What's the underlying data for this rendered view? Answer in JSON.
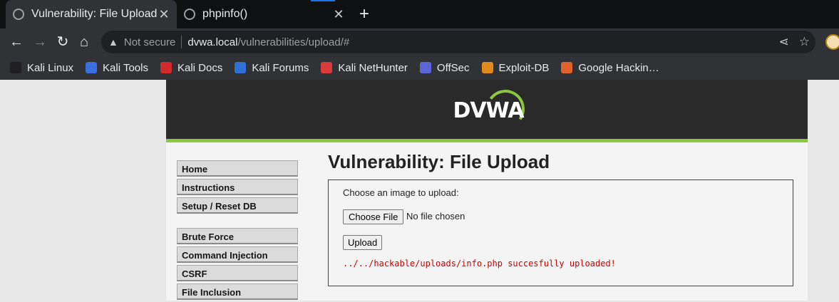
{
  "browser": {
    "tabs": [
      {
        "title": "Vulnerability: File Upload",
        "active": true
      },
      {
        "title": "phpinfo()",
        "active": false
      }
    ],
    "new_tab": "+",
    "nav": {
      "back": "←",
      "forward": "→",
      "reload": "↻",
      "home": "⌂"
    },
    "omnibox": {
      "security_icon": "warning-triangle-icon",
      "security_text": "Not secure",
      "url_host": "dvwa.local",
      "url_path": "/vulnerabilities/upload/#"
    },
    "bookmarks": [
      {
        "label": "Kali Linux",
        "icon": "kali-dragon-icon",
        "color": "#1f1f1f"
      },
      {
        "label": "Kali Tools",
        "icon": "kali-tools-icon",
        "color": "#3d6ee0"
      },
      {
        "label": "Kali Docs",
        "icon": "kali-docs-icon",
        "color": "#d12a2a"
      },
      {
        "label": "Kali Forums",
        "icon": "kali-forums-icon",
        "color": "#2f6fd6"
      },
      {
        "label": "Kali NetHunter",
        "icon": "nethunter-icon",
        "color": "#d93a3a"
      },
      {
        "label": "OffSec",
        "icon": "offsec-icon",
        "color": "#5a66d6"
      },
      {
        "label": "Exploit-DB",
        "icon": "exploit-db-spider-icon",
        "color": "#e08a1a"
      },
      {
        "label": "Google Hackin…",
        "icon": "ghdb-icon",
        "color": "#e0622a"
      }
    ]
  },
  "dvwa": {
    "logo_text": "DVWA",
    "menu_group1": [
      "Home",
      "Instructions",
      "Setup / Reset DB"
    ],
    "menu_group2": [
      "Brute Force",
      "Command Injection",
      "CSRF",
      "File Inclusion"
    ],
    "page_title": "Vulnerability: File Upload",
    "form": {
      "label": "Choose an image to upload:",
      "choose_file_button": "Choose File",
      "no_file_text": "No file chosen",
      "upload_button": "Upload",
      "result_message": "../../hackable/uploads/info.php succesfully uploaded!"
    },
    "colors": {
      "accent_green": "#8dc63f",
      "error_red": "#cc0000",
      "header_dark": "#2a2a2a"
    }
  }
}
